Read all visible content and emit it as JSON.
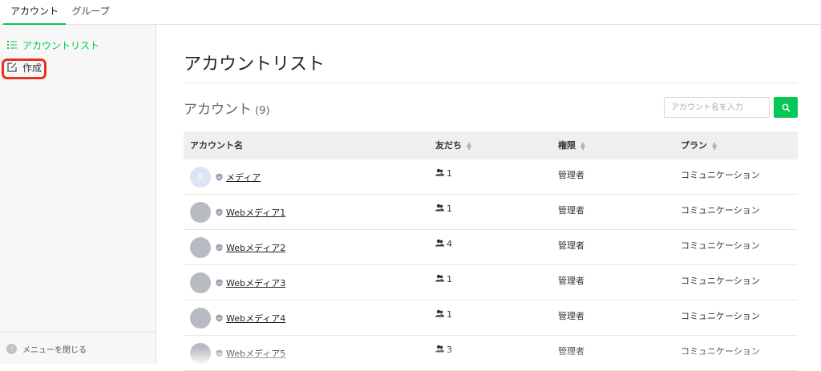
{
  "tabs": [
    {
      "label": "アカウント",
      "active": true
    },
    {
      "label": "グループ",
      "active": false
    }
  ],
  "sidebar": {
    "items": [
      {
        "label": "アカウントリスト",
        "icon": "list-icon",
        "active": true
      },
      {
        "label": "作成",
        "icon": "edit-icon",
        "highlighted": true
      }
    ],
    "collapse_label": "メニューを閉じる"
  },
  "page": {
    "title": "アカウントリスト",
    "section_title": "アカウント",
    "count": "(9)"
  },
  "search": {
    "placeholder": "アカウント名を入力",
    "button_icon": "search-icon"
  },
  "table": {
    "headers": [
      "アカウント名",
      "友だち",
      "権限",
      "プラン"
    ],
    "rows": [
      {
        "name": "メディア",
        "friends": "1",
        "role": "管理者",
        "plan": "コミュニケーション"
      },
      {
        "name": "Webメディア1",
        "friends": "1",
        "role": "管理者",
        "plan": "コミュニケーション"
      },
      {
        "name": "Webメディア2",
        "friends": "4",
        "role": "管理者",
        "plan": "コミュニケーション"
      },
      {
        "name": "Webメディア3",
        "friends": "1",
        "role": "管理者",
        "plan": "コミュニケーション"
      },
      {
        "name": "Webメディア4",
        "friends": "1",
        "role": "管理者",
        "plan": "コミュニケーション"
      },
      {
        "name": "Webメディア5",
        "friends": "3",
        "role": "管理者",
        "plan": "コミュニケーション"
      }
    ]
  },
  "colors": {
    "accent": "#06c755",
    "highlight": "#e53222",
    "sidebar_bg": "#f7f7f7",
    "header_bg": "#efeff1"
  }
}
